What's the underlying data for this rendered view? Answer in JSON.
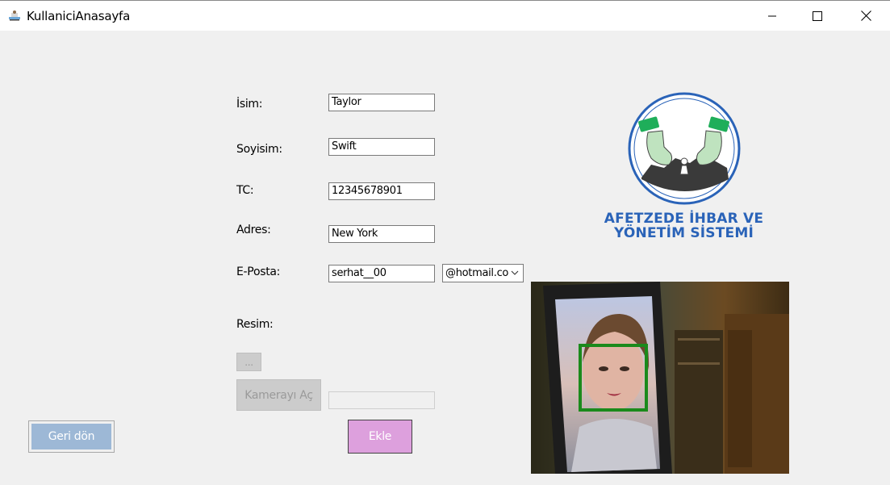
{
  "window": {
    "title": "KullaniciAnasayfa"
  },
  "form": {
    "isim_label": "İsim:",
    "isim_value": "Taylor",
    "soyisim_label": "Soyisim:",
    "soyisim_value": "Swift",
    "tc_label": "TC:",
    "tc_value": "12345678901",
    "adres_label": "Adres:",
    "adres_value": "New York",
    "eposta_label": "E-Posta:",
    "eposta_value": "serhat__00",
    "eposta_domain": "@hotmail.co",
    "resim_label": "Resim:",
    "browse_label": "...",
    "path_value": ""
  },
  "buttons": {
    "camera_label": "Kamerayı Aç",
    "back_label": "Geri dön",
    "add_label": "Ekle"
  },
  "logo": {
    "line1": "AFETZEDE İHBAR VE",
    "line2": "YÖNETİM SİSTEMİ"
  },
  "icons": {
    "app": "app-icon",
    "minimize": "minimize-icon",
    "maximize": "maximize-icon",
    "close": "close-icon",
    "dropdown": "chevron-down-icon"
  },
  "colors": {
    "back_button": "#9db8d6",
    "add_button": "#dda0dd",
    "logo_blue": "#2a63b8",
    "face_box": "#1b8a1b"
  }
}
